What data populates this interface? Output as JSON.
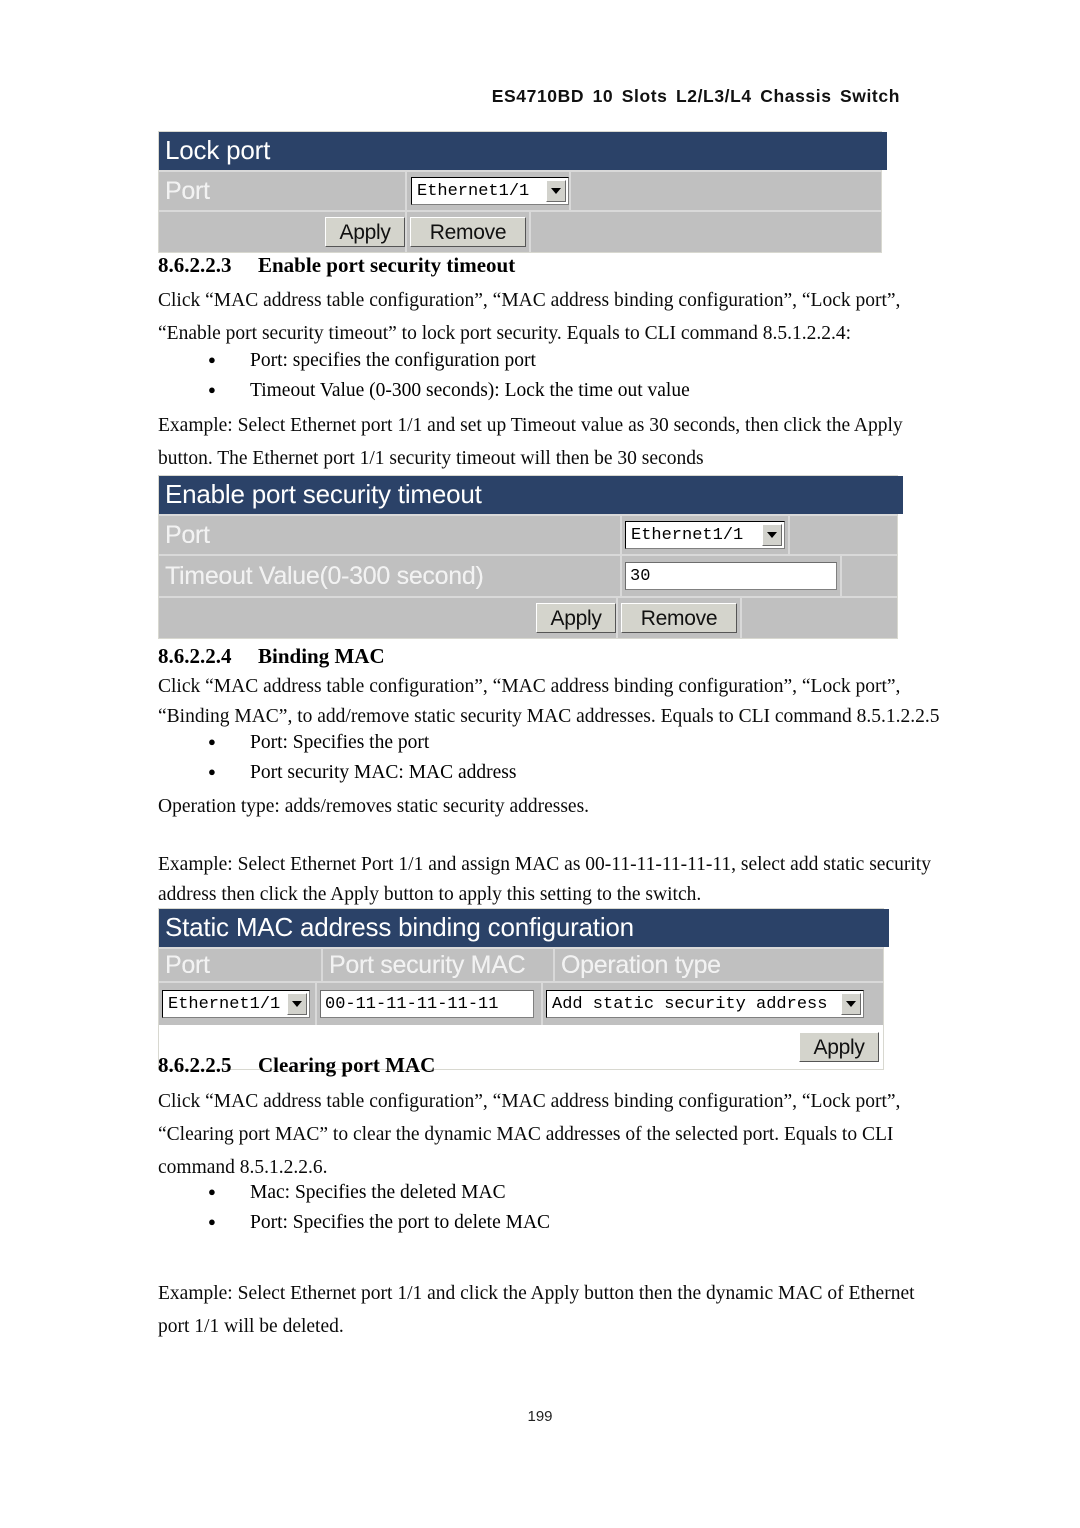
{
  "header": {
    "running_title": "ES4710BD 10 Slots L2/L3/L4 Chassis Switch"
  },
  "page_number": "199",
  "panel_lock_port": {
    "title": "Lock port",
    "port_label": "Port",
    "port_value": "Ethernet1/1",
    "apply_label": "Apply",
    "remove_label": "Remove"
  },
  "section_timeout": {
    "number": "8.6.2.2.3",
    "title": "Enable port security timeout",
    "para1_line1": "Click “MAC address table configuration”, “MAC address binding configuration”, “Lock port”,",
    "para1_line2": "“Enable port security timeout” to lock port security. Equals to CLI command 8.5.1.2.2.4:",
    "bullets": [
      "Port: specifies the   configuration port",
      "Timeout Value (0-300 seconds): Lock the time out value"
    ],
    "para2_line1": "Example: Select Ethernet port 1/1 and set up Timeout value as 30 seconds, then click the Apply",
    "para2_line2": "button. The Ethernet port 1/1 security timeout will then be 30 seconds"
  },
  "panel_timeout": {
    "title": "Enable port security timeout",
    "port_label": "Port",
    "port_value": "Ethernet1/1",
    "timeout_label": "Timeout Value(0-300 second)",
    "timeout_value": "30",
    "apply_label": "Apply",
    "remove_label": "Remove"
  },
  "section_binding": {
    "number": "8.6.2.2.4",
    "title": "Binding MAC",
    "para1_line1": "Click “MAC address table configuration”, “MAC address binding configuration”, “Lock port”,",
    "para1_line2": "“Binding MAC”, to add/remove static security MAC addresses. Equals to CLI command 8.5.1.2.2.5",
    "bullets": [
      "Port: Specifies the port",
      "Port security MAC: MAC address"
    ],
    "para2": "Operation type: adds/removes static security addresses.",
    "para3_line1": "Example: Select Ethernet Port 1/1 and assign MAC as 00-11-11-11-11-11, select add static security",
    "para3_line2": "address then click the Apply button to apply this setting to the switch."
  },
  "panel_static_mac": {
    "title": "Static MAC address binding configuration",
    "col_port": "Port",
    "col_security_mac": "Port security MAC",
    "col_operation_type": "Operation type",
    "port_value": "Ethernet1/1",
    "mac_value": "00-11-11-11-11-11",
    "operation_value": "Add static security address",
    "apply_label": "Apply"
  },
  "section_clearing": {
    "number": "8.6.2.2.5",
    "title": "Clearing port MAC",
    "para1_line1": "Click “MAC address table configuration”, “MAC address binding configuration”, “Lock port”,",
    "para1_line2": "“Clearing port MAC” to clear the dynamic MAC addresses of the selected port. Equals to CLI",
    "para1_line3": "command 8.5.1.2.2.6.",
    "bullets": [
      "Mac: Specifies the deleted MAC",
      "Port: Specifies the port to delete MAC"
    ],
    "para2_line1": "Example: Select Ethernet port 1/1 and click the Apply button then the dynamic MAC of Ethernet",
    "para2_line2": "port 1/1 will be deleted."
  },
  "colors": {
    "panel_header_blue": "#2b4268",
    "panel_body_gray": "#c0c0c0",
    "button_face": "#d4d4cc"
  }
}
